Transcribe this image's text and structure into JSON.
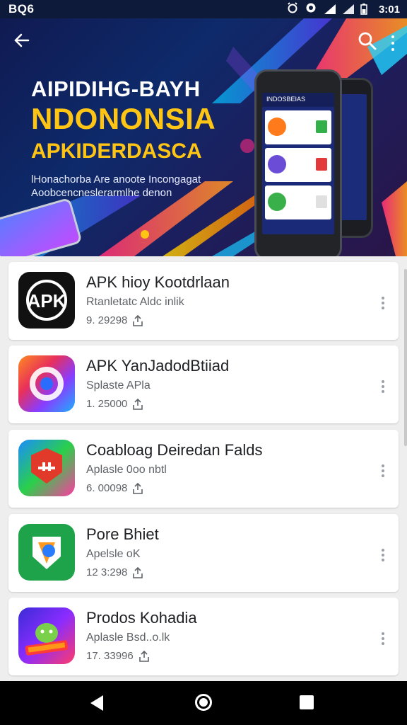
{
  "status_bar": {
    "time_left": "BQ6",
    "time_right": "3:01"
  },
  "header": {
    "back_icon": "arrow-left-icon",
    "search_icon": "search-icon",
    "more_icon": "more-vert-icon"
  },
  "hero": {
    "title_line1": "AIPIDIHG-BAYH",
    "title_line2": "NDONONSIA",
    "title_line3": "APKIDERDASCA",
    "subtitle": "lHonachorba Are anoote Incongagat Aoobcencneslerarmlhe denon",
    "phone_bar_text": "INDOSBEIAS",
    "colors": {
      "title_white": "#ffffff",
      "title_yellow": "#ffc515"
    }
  },
  "apps": [
    {
      "name": "APK hioy Kootdrlaan",
      "desc": "Rtanletatc Aldc inlik",
      "meta": "9. 29298",
      "icon": "apk-logo-icon"
    },
    {
      "name": "APK YanJadodBtiiad",
      "desc": "Splaste APla",
      "meta": "1. 25000",
      "icon": "chrome-like-icon"
    },
    {
      "name": "Coabloag Deiredan Falds",
      "desc": "Aplasle 0oo nbtl",
      "meta": "6. 00098",
      "icon": "red-shield-icon"
    },
    {
      "name": "Pore Bhiet",
      "desc": "Apelsle oK",
      "meta": "12 3:298",
      "icon": "maps-shield-icon"
    },
    {
      "name": "Prodos Kohadia",
      "desc": "Aplasle Bsd..o.lk",
      "meta": "17. 33996",
      "icon": "android-badge-icon"
    }
  ],
  "nav": {
    "back_icon": "nav-back-icon",
    "home_icon": "nav-home-icon",
    "recents_icon": "nav-recents-icon"
  }
}
